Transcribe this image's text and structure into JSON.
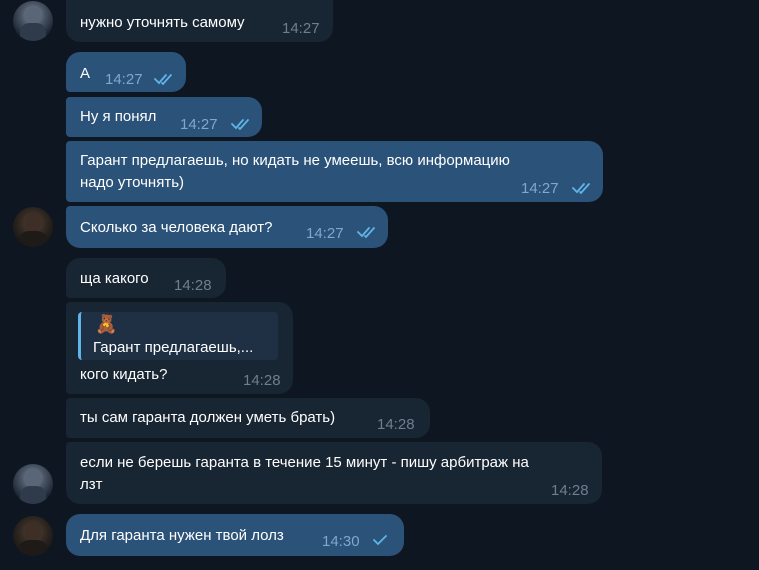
{
  "messages": [
    {
      "text": "нужно уточнять самому",
      "time": "14:27"
    },
    {
      "text": "А",
      "time": "14:27"
    },
    {
      "text": "Ну я понял",
      "time": "14:27"
    },
    {
      "text_line1": "Гарант предлагаешь, но кидать не умеешь, всю информацию",
      "text_line2": "надо уточнять)",
      "time": "14:27"
    },
    {
      "text": "Сколько за человека дают?",
      "time": "14:27"
    },
    {
      "text": "ща какого",
      "time": "14:28"
    },
    {
      "reply_emoji": "🧸",
      "reply_text": "Гарант предлагаешь,...",
      "text": "кого кидать?",
      "time": "14:28"
    },
    {
      "text": "ты сам гаранта должен уметь брать)",
      "time": "14:28"
    },
    {
      "text_line1": "если не берешь гаранта в течение 15 минут - пишу арбитраж на",
      "text_line2": "лзт",
      "time": "14:28"
    },
    {
      "text": "Для гаранта нужен твой лолз",
      "time": "14:30"
    }
  ],
  "icons": {
    "double_check": "double-check-icon",
    "single_check": "single-check-icon"
  },
  "colors": {
    "background": "#0e1621",
    "incoming_bubble": "#182533",
    "outgoing_bubble": "#2b5278",
    "check_color": "#5fb5e8"
  }
}
